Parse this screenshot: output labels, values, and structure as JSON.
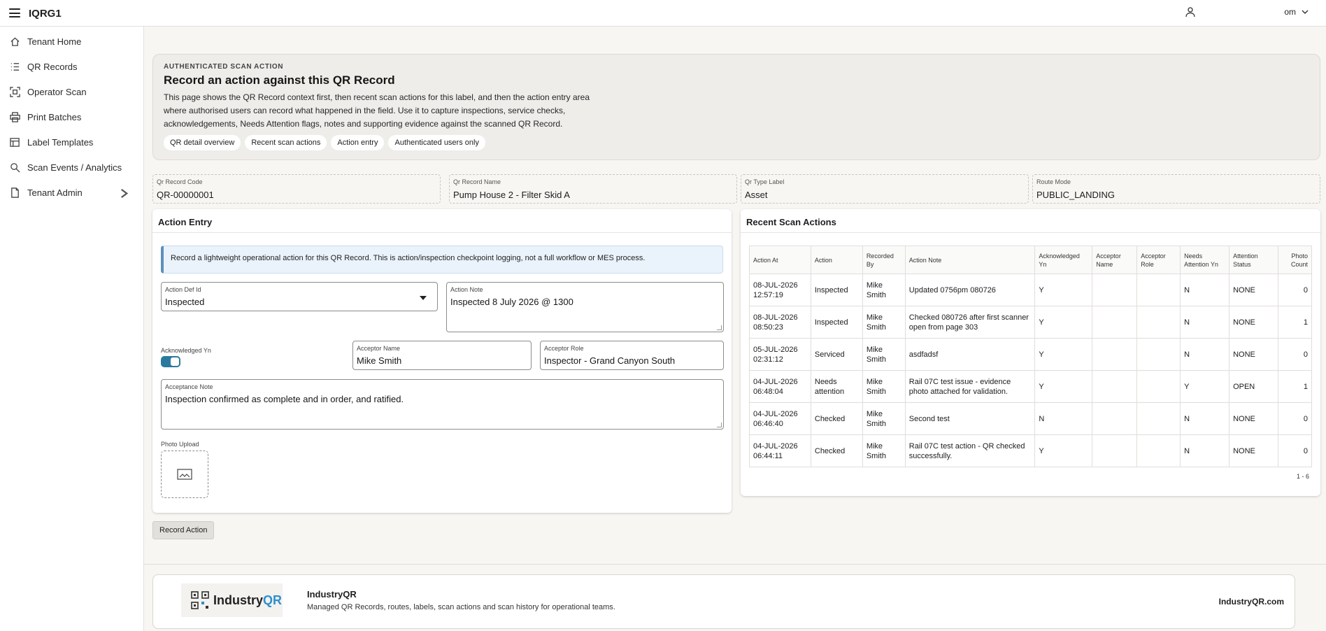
{
  "header": {
    "app_title": "IQRG1",
    "user_email": "om"
  },
  "sidebar": {
    "items": [
      {
        "label": "Tenant Home",
        "icon": "home-icon"
      },
      {
        "label": "QR Records",
        "icon": "list-icon"
      },
      {
        "label": "Operator Scan",
        "icon": "scan-icon"
      },
      {
        "label": "Print Batches",
        "icon": "printer-icon"
      },
      {
        "label": "Label Templates",
        "icon": "template-icon"
      },
      {
        "label": "Scan Events / Analytics",
        "icon": "analytics-icon"
      },
      {
        "label": "Tenant Admin",
        "icon": "document-icon"
      }
    ]
  },
  "hero": {
    "kicker": "AUTHENTICATED SCAN ACTION",
    "title": "Record an action against this QR Record",
    "description": "This page shows the QR Record context first, then recent scan actions for this label, and then the action entry area where authorised users can record what happened in the field. Use it to capture inspections, service checks, acknowledgements, Needs Attention flags, notes and supporting evidence against the scanned QR Record.",
    "chips": [
      "QR detail overview",
      "Recent scan actions",
      "Action entry",
      "Authenticated users only"
    ]
  },
  "record_fields": [
    {
      "label": "Qr Record Code",
      "value": "QR-00000001"
    },
    {
      "label": "Qr Record Name",
      "value": "Pump House 2 - Filter Skid A"
    },
    {
      "label": "Qr Type Label",
      "value": "Asset"
    },
    {
      "label": "Route Mode",
      "value": "PUBLIC_LANDING"
    }
  ],
  "action_entry": {
    "title": "Action Entry",
    "info": "Record a lightweight operational action for this QR Record. This is action/inspection checkpoint logging, not a full workflow or MES process.",
    "action_def": {
      "label": "Action Def Id",
      "value": "Inspected"
    },
    "action_note": {
      "label": "Action Note",
      "value": "Inspected 8 July 2026 @ 1300"
    },
    "acknowledged": {
      "label": "Acknowledged Yn",
      "on": true
    },
    "acceptor_name": {
      "label": "Acceptor Name",
      "value": "Mike Smith"
    },
    "acceptor_role": {
      "label": "Acceptor Role",
      "value": "Inspector - Grand Canyon South"
    },
    "acceptance_note": {
      "label": "Acceptance Note",
      "value": "Inspection confirmed as complete and in order, and ratified."
    },
    "photo_upload": {
      "label": "Photo Upload"
    },
    "record_button": "Record Action"
  },
  "recent": {
    "title": "Recent Scan Actions",
    "columns": [
      "Action At",
      "Action",
      "Recorded By",
      "Action Note",
      "Acknowledged Yn",
      "Acceptor Name",
      "Acceptor Role",
      "Needs Attention Yn",
      "Attention Status",
      "Photo Count"
    ],
    "rows": [
      [
        "08-JUL-2026 12:57:19",
        "Inspected",
        "Mike Smith",
        "Updated 0756pm 080726",
        "Y",
        "",
        "",
        "N",
        "NONE",
        "0"
      ],
      [
        "08-JUL-2026 08:50:23",
        "Inspected",
        "Mike Smith",
        "Checked 080726 after first scanner open from page 303",
        "Y",
        "",
        "",
        "N",
        "NONE",
        "1"
      ],
      [
        "05-JUL-2026 02:31:12",
        "Serviced",
        "Mike Smith",
        "asdfadsf",
        "Y",
        "",
        "",
        "N",
        "NONE",
        "0"
      ],
      [
        "04-JUL-2026 06:48:04",
        "Needs attention",
        "Mike Smith",
        "Rail 07C test issue - evidence photo attached for validation.",
        "Y",
        "",
        "",
        "Y",
        "OPEN",
        "1"
      ],
      [
        "04-JUL-2026 06:46:40",
        "Checked",
        "Mike Smith",
        "Second test",
        "N",
        "",
        "",
        "N",
        "NONE",
        "0"
      ],
      [
        "04-JUL-2026 06:44:11",
        "Checked",
        "Mike Smith",
        "Rail 07C test action - QR checked successfully.",
        "Y",
        "",
        "",
        "N",
        "NONE",
        "0"
      ]
    ],
    "pager": "1 - 6"
  },
  "footer": {
    "logo_text_a": "Industry",
    "logo_text_b": "QR",
    "brand": "IndustryQR",
    "tagline": "Managed QR Records, routes, labels, scan actions and scan history for operational teams.",
    "url": "IndustryQR.com"
  }
}
